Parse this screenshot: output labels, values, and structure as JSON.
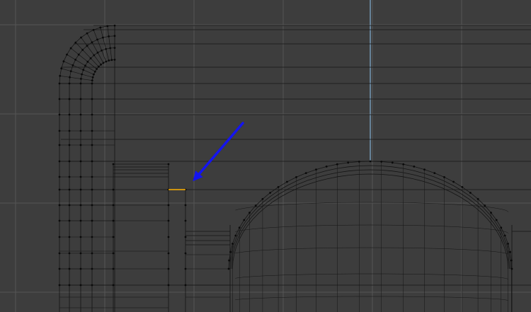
{
  "viewport": {
    "background": "#3d3d3d",
    "grid_color": "#555555",
    "grid_minor_color": "#4a4a4a",
    "axis_color": "#8fc6f2",
    "mesh_edge_color": "#151515",
    "mesh_vertex_color": "#0a0a0a",
    "selected_edge_color": "#ffb100",
    "annotation_arrow_color": "#1414f0"
  },
  "icons": {
    "annotation": "arrow-pointer-icon"
  }
}
